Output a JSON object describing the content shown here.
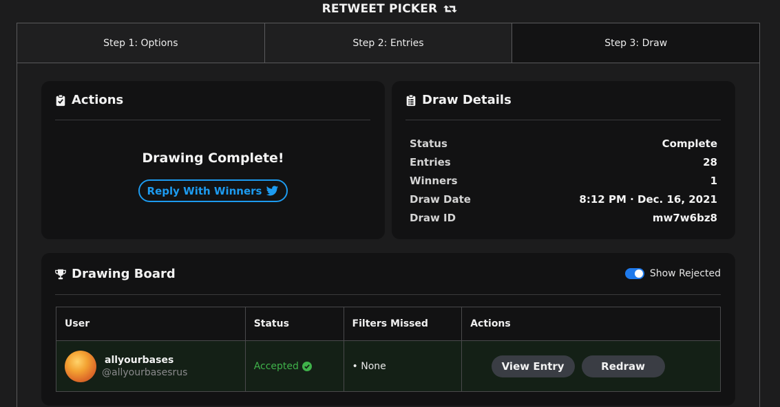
{
  "app": {
    "title": "RETWEET PICKER",
    "title_icon": "retweet-icon"
  },
  "tabs": [
    {
      "label": "Step 1: Options",
      "active": false
    },
    {
      "label": "Step 2: Entries",
      "active": false
    },
    {
      "label": "Step 3: Draw",
      "active": true
    }
  ],
  "actions": {
    "title": "Actions",
    "icon": "clipboard-check-icon",
    "message": "Drawing Complete!",
    "reply_button": "Reply With Winners",
    "reply_icon": "twitter-bird-icon",
    "accent": "#1d9bf0"
  },
  "draw_details": {
    "title": "Draw Details",
    "icon": "clipboard-list-icon",
    "rows": [
      {
        "key": "Status",
        "value": "Complete"
      },
      {
        "key": "Entries",
        "value": "28"
      },
      {
        "key": "Winners",
        "value": "1"
      },
      {
        "key": "Draw Date",
        "value": "8:12 PM · Dec. 16, 2021"
      },
      {
        "key": "Draw ID",
        "value": "mw7w6bz8"
      }
    ]
  },
  "board": {
    "title": "Drawing Board",
    "icon": "trophy-icon",
    "toggle_label": "Show Rejected",
    "toggle_on": true,
    "columns": [
      "User",
      "Status",
      "Filters Missed",
      "Actions"
    ],
    "rows": [
      {
        "name": "allyourbases",
        "handle": "@allyourbasesrus",
        "status": "Accepted",
        "filters_missed": "• None",
        "view_label": "View Entry",
        "redraw_label": "Redraw"
      }
    ]
  },
  "colors": {
    "accepted": "#3fb24a",
    "toggle": "#1f7aec",
    "row_bg": "#142016"
  }
}
